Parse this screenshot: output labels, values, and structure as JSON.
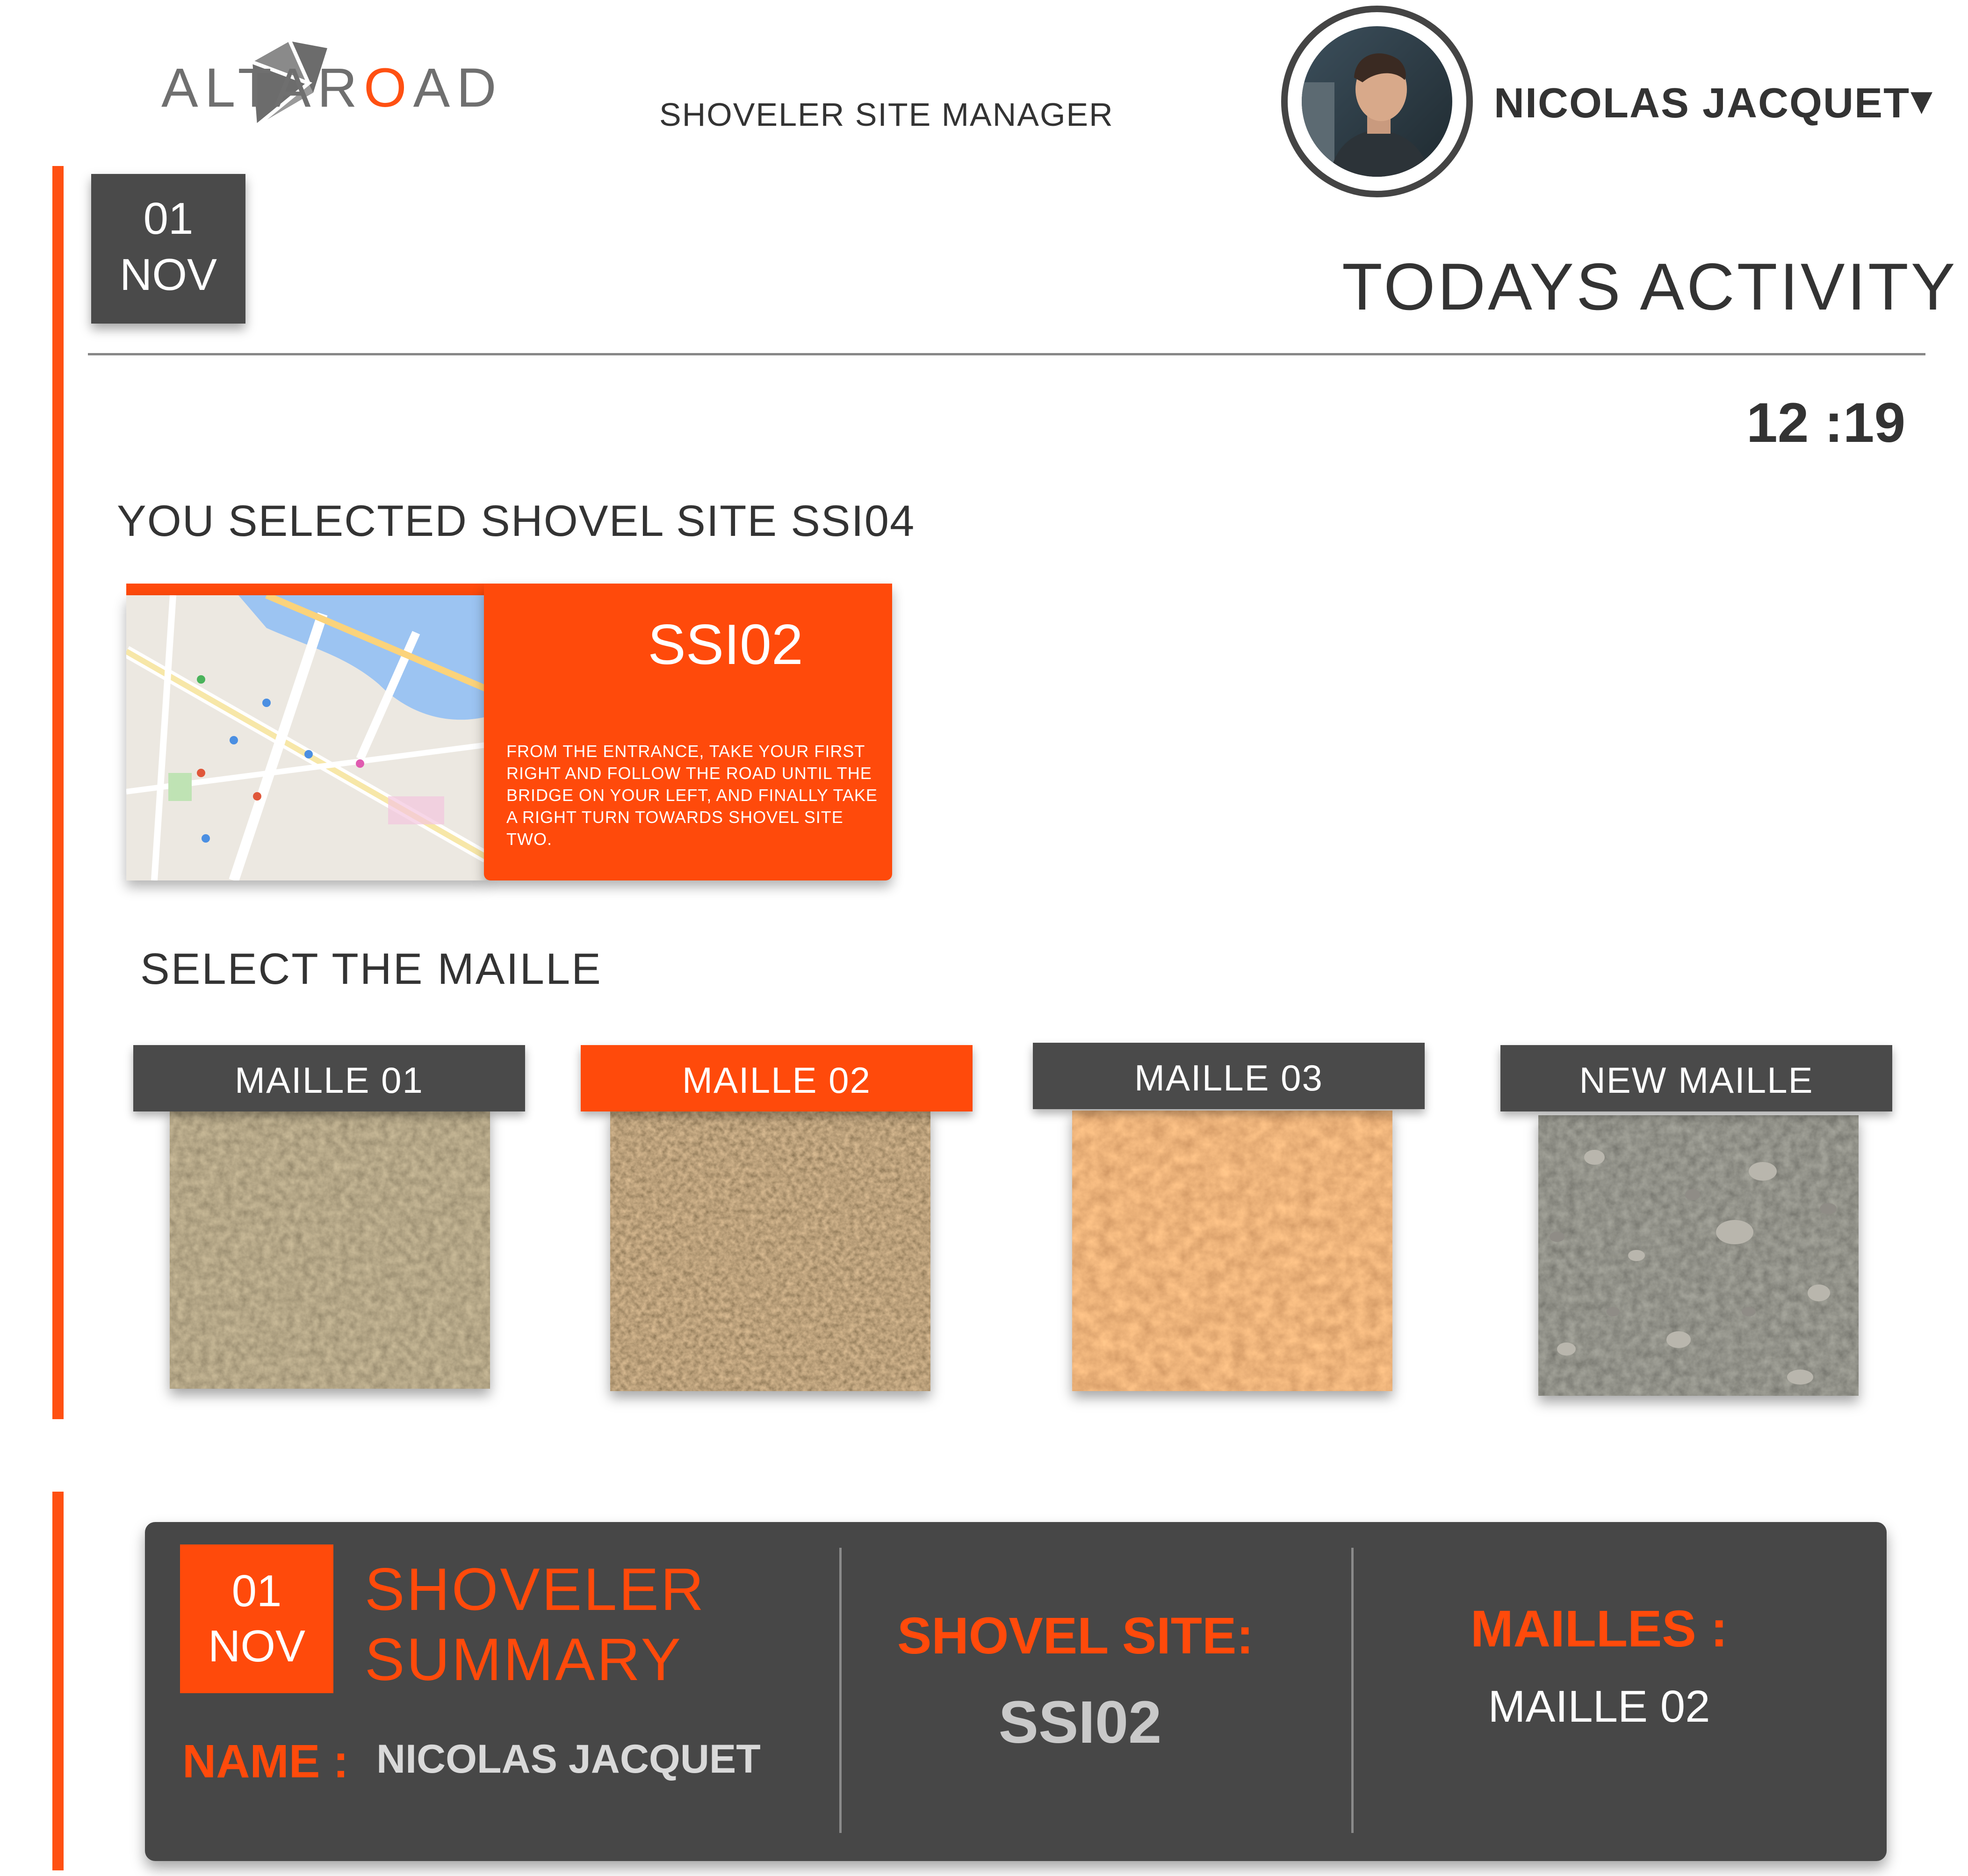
{
  "header": {
    "brand": {
      "text_main": "ALTAR",
      "text_accent": "O",
      "text_end": "AD"
    },
    "app_title": "SHOVELER SITE MANAGER",
    "user": {
      "name": "NICOLAS JACQUET",
      "caret": "▼"
    }
  },
  "date": {
    "day": "01",
    "month": "NOV"
  },
  "activity": {
    "title": "TODAYS ACTIVITY",
    "time": "12 :19"
  },
  "selected_site": {
    "heading": "YOU SELECTED SHOVEL SITE SSI04",
    "code": "SSI02",
    "directions": "FROM THE ENTRANCE, TAKE YOUR FIRST RIGHT AND FOLLOW THE ROAD UNTIL THE BRIDGE ON YOUR LEFT, AND FINALLY TAKE A RIGHT TURN TOWARDS SHOVEL SITE TWO."
  },
  "maille_select": {
    "heading": "SELECT THE MAILLE",
    "items": [
      {
        "label": "MAILLE 01",
        "selected": false,
        "texture": "brown-gravel-soil"
      },
      {
        "label": "MAILLE 02",
        "selected": true,
        "texture": "clumpy-brown-soil"
      },
      {
        "label": "MAILLE 03",
        "selected": false,
        "texture": "orange-clay"
      },
      {
        "label": "NEW MAILLE",
        "selected": false,
        "texture": "dark-gravel"
      }
    ]
  },
  "summary": {
    "date": {
      "day": "01",
      "month": "NOV"
    },
    "title_line1": "SHOVELER",
    "title_line2": "SUMMARY",
    "name_label": "NAME :",
    "name_value": "NICOLAS JACQUET",
    "site_label": "SHOVEL SITE:",
    "site_value": "SSI02",
    "mailles_label": "MAILLES :",
    "mailles_value": "MAILLE 02"
  },
  "colors": {
    "accent": "#ff4a0b",
    "dark": "#474747",
    "text": "#333333"
  }
}
